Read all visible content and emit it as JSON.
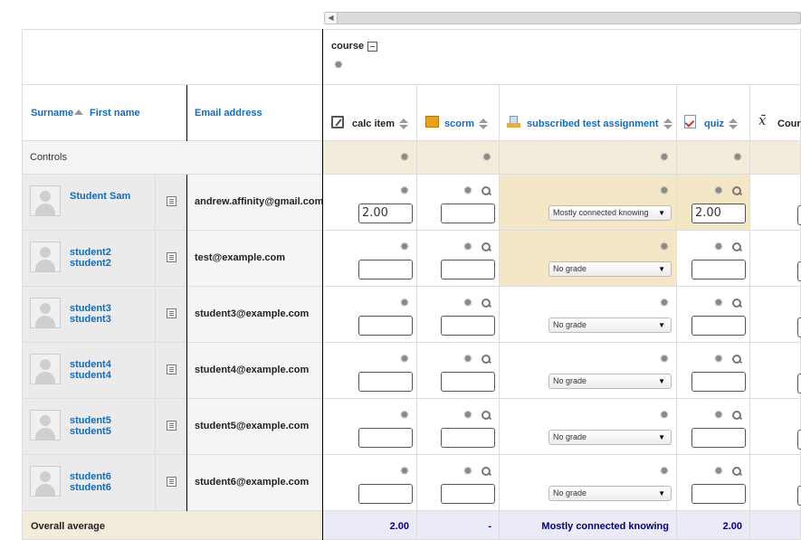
{
  "scroll_arrow": "◀",
  "gear": "✹",
  "category": {
    "name": "course"
  },
  "header": {
    "surname": "Surname",
    "firstname": "First name",
    "email": "Email address",
    "items": [
      {
        "name": "calc item",
        "icon": "calculator-icon"
      },
      {
        "name": "scorm",
        "icon": "scorm-package-icon"
      },
      {
        "name": "subscribed test assignment",
        "icon": "assignment-icon"
      },
      {
        "name": "quiz",
        "icon": "quiz-icon"
      },
      {
        "name": "Cours",
        "icon": "course-total-icon"
      }
    ]
  },
  "controls_label": "Controls",
  "students": [
    {
      "name": "Student Sam",
      "email": "andrew.affinity@gmail.com",
      "calc": "2.00",
      "scorm": "",
      "assign": "Mostly connected knowing",
      "quiz": "2.00"
    },
    {
      "name": "student2 student2",
      "email": "test@example.com",
      "calc": "",
      "scorm": "",
      "assign": "No grade",
      "quiz": ""
    },
    {
      "name": "student3 student3",
      "email": "student3@example.com",
      "calc": "",
      "scorm": "",
      "assign": "No grade",
      "quiz": ""
    },
    {
      "name": "student4 student4",
      "email": "student4@example.com",
      "calc": "",
      "scorm": "",
      "assign": "No grade",
      "quiz": ""
    },
    {
      "name": "student5 student5",
      "email": "student5@example.com",
      "calc": "",
      "scorm": "",
      "assign": "No grade",
      "quiz": ""
    },
    {
      "name": "student6 student6",
      "email": "student6@example.com",
      "calc": "",
      "scorm": "",
      "assign": "No grade",
      "quiz": ""
    }
  ],
  "average": {
    "label": "Overall average",
    "calc": "2.00",
    "scorm": "-",
    "assign": "Mostly connected knowing",
    "quiz": "2.00"
  },
  "colors": {
    "overridden": "#f3e7c5",
    "average_bg": "#ebebf8",
    "average_label_bg": "#f3ecdb",
    "controls_item_bg": "#f3ecdb",
    "link": "#0f6cbf",
    "average_text": "#000080"
  }
}
